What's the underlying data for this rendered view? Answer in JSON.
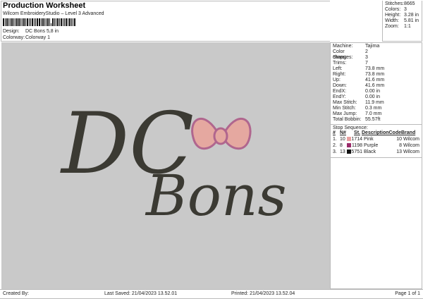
{
  "header": {
    "title": "Production Worksheet",
    "subtitle": "Wilcom EmbroideryStudio – Level 3 Advanced",
    "design_label": "Design:",
    "design_value": "DC Bons 5,8 in",
    "colorway_label": "Colorway:",
    "colorway_value": "Colorway 1"
  },
  "stats": [
    {
      "k": "Stitches:",
      "v": "8665"
    },
    {
      "k": "Colors:",
      "v": "3"
    },
    {
      "k": "Height:",
      "v": "3.28 in"
    },
    {
      "k": "Width:",
      "v": "5.81 in"
    },
    {
      "k": "Zoom:",
      "v": "1:1"
    }
  ],
  "design": {
    "text_top": "DC",
    "text_bottom": "Bons",
    "thread_color": "#3b3a33",
    "bow_fill": "#e5a8a0",
    "bow_outline": "#b0668e"
  },
  "details": [
    {
      "k": "Machine:",
      "v": "Tajima"
    },
    {
      "k": "Color changes:",
      "v": "2"
    },
    {
      "k": "Stops:",
      "v": "3"
    },
    {
      "k": "Trims:",
      "v": "7"
    },
    {
      "k": "Left:",
      "v": "73.8 mm"
    },
    {
      "k": "Right:",
      "v": "73.8 mm"
    },
    {
      "k": "Up:",
      "v": "41.6 mm"
    },
    {
      "k": "Down:",
      "v": "41.6 mm"
    },
    {
      "k": "EndX:",
      "v": "0.00 in"
    },
    {
      "k": "EndY:",
      "v": "0.00 in"
    },
    {
      "k": "Max Stitch:",
      "v": "11.9 mm"
    },
    {
      "k": "Min Stitch:",
      "v": "0.3 mm"
    },
    {
      "k": "Max Jump:",
      "v": "7.0 mm"
    },
    {
      "k": "Total Bobbin:",
      "v": "55.57ft"
    }
  ],
  "stop_sequence": {
    "title": "Stop Sequence:",
    "headers": [
      "#",
      "N#",
      "St.",
      "Description",
      "Code",
      "Brand"
    ],
    "rows": [
      {
        "n": "1.",
        "needle": "10",
        "color": "#e8a0a0",
        "st": "1714",
        "desc": "Pink",
        "code": "10",
        "brand": "Wilcom"
      },
      {
        "n": "2.",
        "needle": "8",
        "color": "#9a2a6a",
        "st": "1198",
        "desc": "Purple",
        "code": "8",
        "brand": "Wilcom"
      },
      {
        "n": "3.",
        "needle": "13",
        "color": "#111111",
        "st": "5751",
        "desc": "Black",
        "code": "13",
        "brand": "Wilcom"
      }
    ]
  },
  "footer": {
    "created": "Created By:",
    "saved": "Last Saved: 21/04/2023 13.52.01",
    "printed": "Printed: 21/04/2023 13.52.04",
    "page": "Page 1 of 1"
  }
}
